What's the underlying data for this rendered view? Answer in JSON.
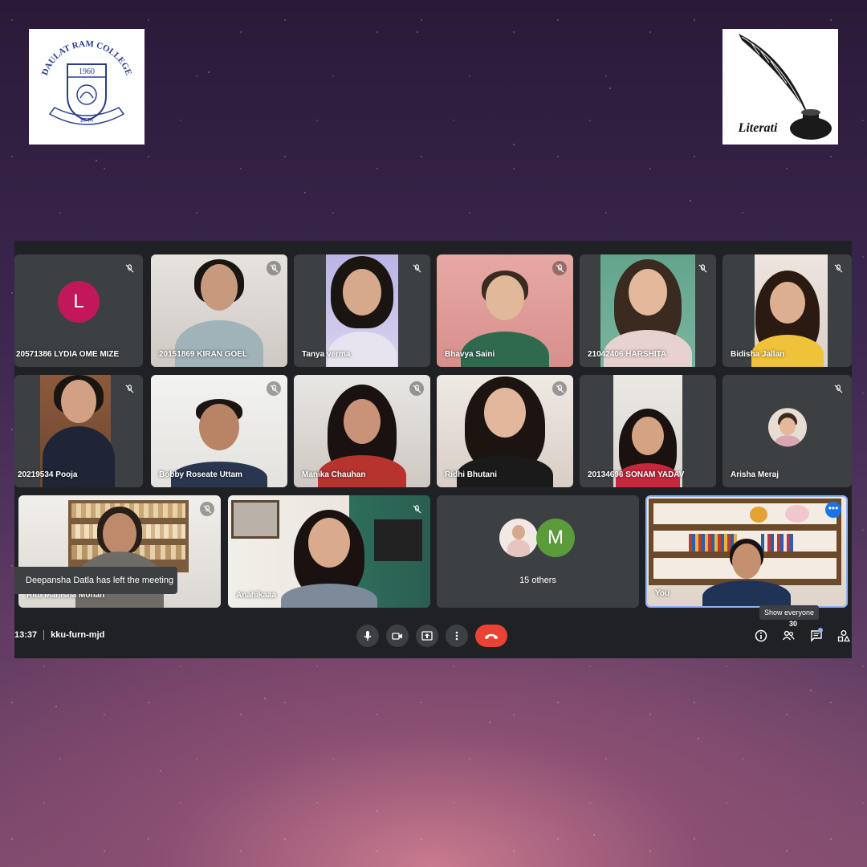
{
  "logos": {
    "left_text": "DAULAT RAM COLLEGE",
    "left_year": "1960",
    "left_motto": "ज्ञानम",
    "right_text": "Literati"
  },
  "participants": [
    {
      "name": "20571386 LYDIA OME MIZE",
      "avatar_letter": "L"
    },
    {
      "name": "20151869 KIRAN GOEL"
    },
    {
      "name": "Tanya verma"
    },
    {
      "name": "Bhavya Saini"
    },
    {
      "name": "21042406 HARSHITA"
    },
    {
      "name": "Bidisha Jallan"
    },
    {
      "name": "20219534 Pooja"
    },
    {
      "name": "Bobby Roseate Uttam"
    },
    {
      "name": "Manika Chauhan"
    },
    {
      "name": "Ridhi Bhutani"
    },
    {
      "name": "20134696 SONAM YADAV"
    },
    {
      "name": "Arisha Meraj"
    },
    {
      "name": "Ritu Manisha Mohan"
    },
    {
      "name": "Anahikaaa"
    },
    {
      "name": "You"
    }
  ],
  "others": {
    "label": "15 others",
    "avatar_letter": "M"
  },
  "toast": "Deepansha Datla has left the meeting",
  "bottom_bar": {
    "time": "13:37",
    "meeting_code": "kku-furn-mjd",
    "tooltip": "Show everyone",
    "people_count": "30"
  },
  "icons": {
    "mic": "mic-icon",
    "camera": "camera-icon",
    "present": "present-icon",
    "more": "more-vert-icon",
    "hangup": "hangup-icon",
    "info": "info-icon",
    "people": "people-icon",
    "chat": "chat-icon",
    "activities": "activities-icon"
  },
  "colors": {
    "meet_bg": "#202124",
    "tile_bg": "#3c4043",
    "hangup": "#ea4335",
    "avatar_L": "#c2185b",
    "avatar_M": "#5b9b3a",
    "active_border": "#8ab4f8"
  }
}
